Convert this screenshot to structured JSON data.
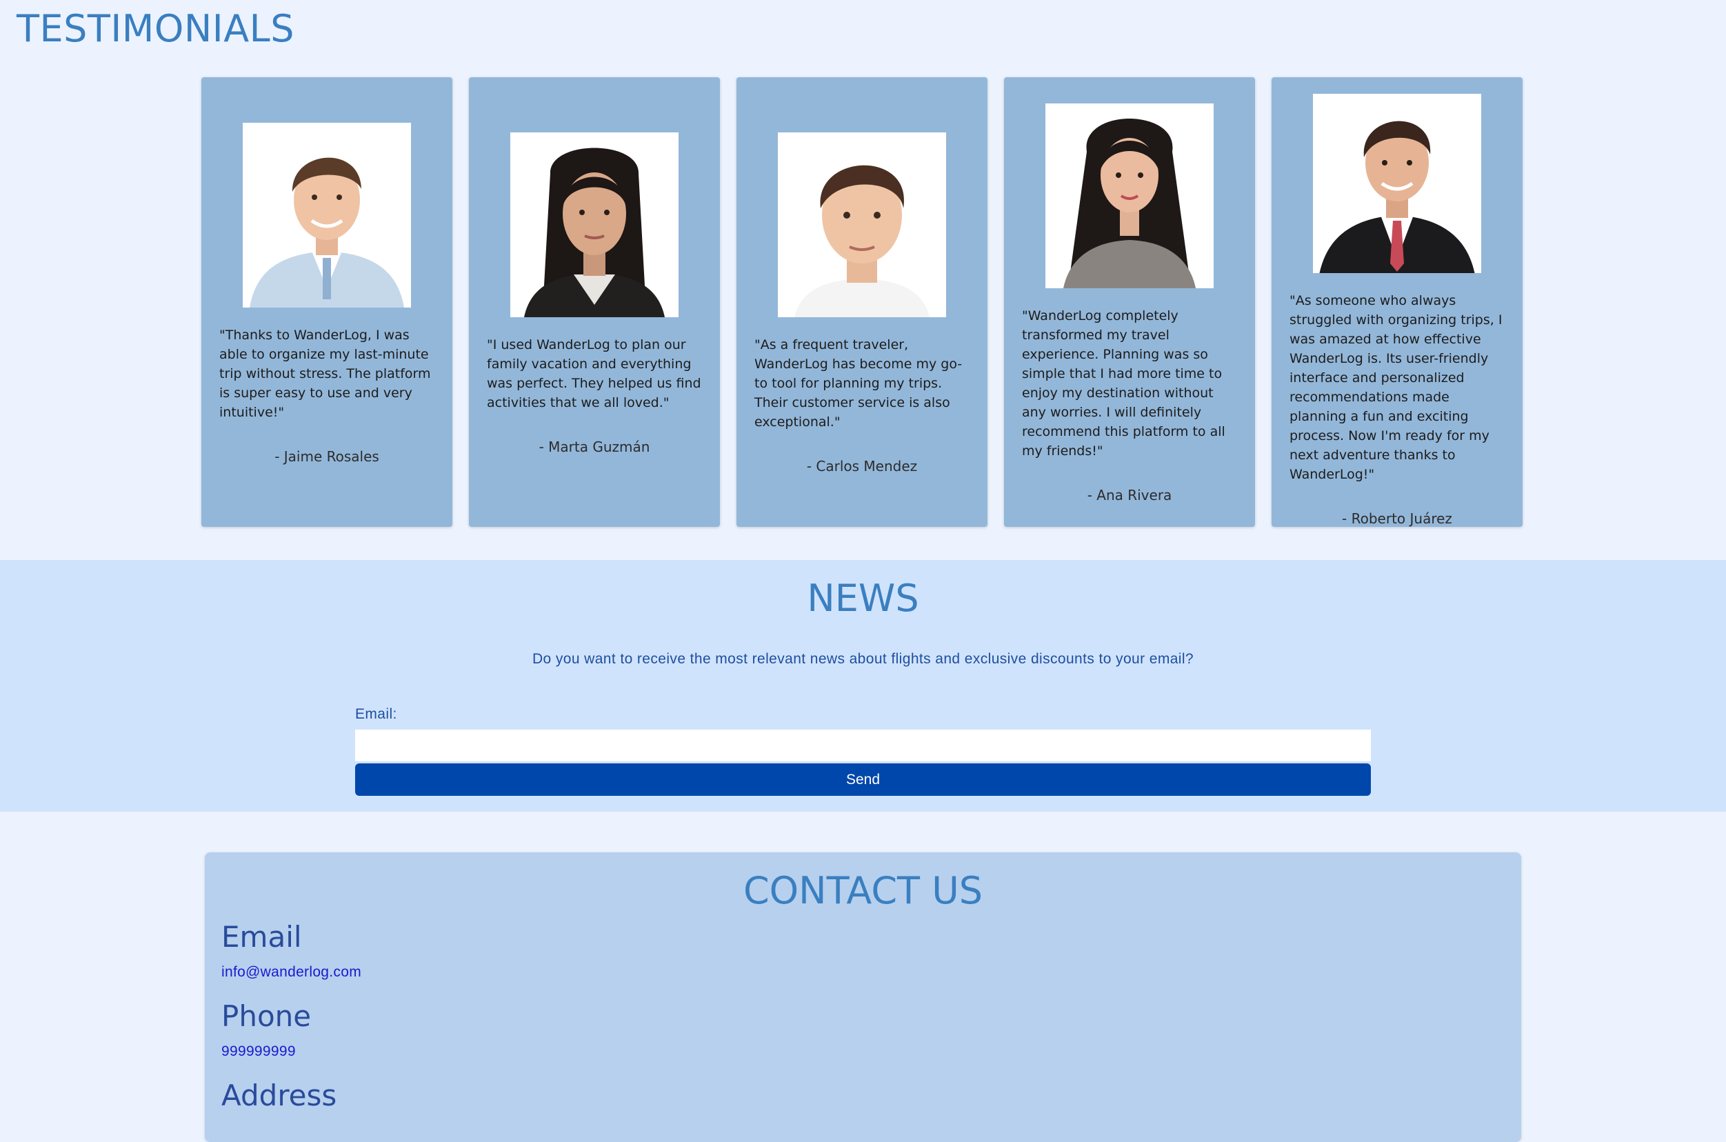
{
  "testimonials": {
    "title": "TESTIMONIALS",
    "cards": [
      {
        "quote": "\"Thanks to WanderLog, I was able to organize my last-minute trip without stress. The platform is super easy to use and very intuitive!\"",
        "author": "- Jaime Rosales",
        "photo_icon": "man-light-blue-suit-photo"
      },
      {
        "quote": "\"I used WanderLog to plan our family vacation and everything was perfect. They helped us find activities that we all loved.\"",
        "author": "- Marta Guzmán",
        "photo_icon": "woman-dark-hair-photo"
      },
      {
        "quote": "\"As a frequent traveler, WanderLog has become my go-to tool for planning my trips. Their customer service is also exceptional.\"",
        "author": "- Carlos Mendez",
        "photo_icon": "man-white-shirt-photo"
      },
      {
        "quote": "\"WanderLog completely transformed my travel experience. Planning was so simple that I had more time to enjoy my destination without any worries. I will definitely recommend this platform to all my friends!\"",
        "author": "- Ana Rivera",
        "photo_icon": "woman-long-hair-photo"
      },
      {
        "quote": "\"As someone who always struggled with organizing trips, I was amazed at how effective WanderLog is. Its user-friendly interface and personalized recommendations made planning a fun and exciting process. Now I'm ready for my next adventure thanks to WanderLog!\"",
        "author": "- Roberto Juárez",
        "photo_icon": "man-black-suit-photo"
      }
    ]
  },
  "news": {
    "title": "NEWS",
    "text": "Do you want to receive the most relevant news about flights and exclusive discounts to your email?",
    "email_label": "Email:",
    "email_value": "",
    "send_label": "Send"
  },
  "contact": {
    "title": "CONTACT US",
    "email_heading": "Email",
    "email_value": "info@wanderlog.com",
    "phone_heading": "Phone",
    "phone_value": "999999999",
    "address_heading": "Address"
  },
  "colors": {
    "page_bg": "#ecf3fe",
    "card_bg": "#93b7d9",
    "news_bg": "#d0e3fc",
    "contact_bg": "#b6d0ee",
    "title_blue": "#3a7fc0",
    "button_blue": "#0047ab",
    "link_blue": "#1a1ad0"
  }
}
